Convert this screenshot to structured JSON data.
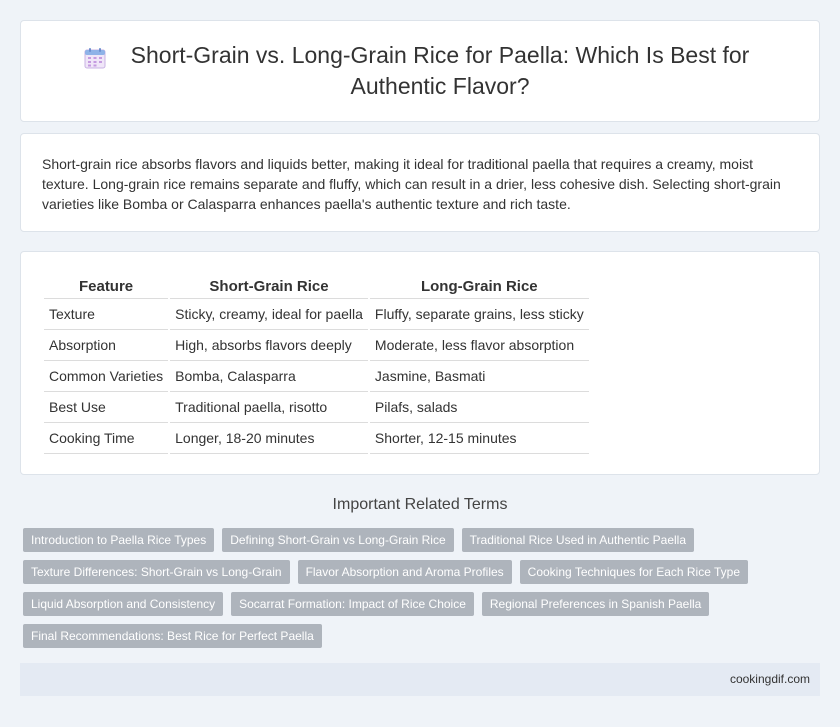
{
  "header": {
    "title": "Short-Grain vs. Long-Grain Rice for Paella: Which Is Best for Authentic Flavor?",
    "icon": "calendar-icon"
  },
  "intro": {
    "text": "Short-grain rice absorbs flavors and liquids better, making it ideal for traditional paella that requires a creamy, moist texture. Long-grain rice remains separate and fluffy, which can result in a drier, less cohesive dish. Selecting short-grain varieties like Bomba or Calasparra enhances paella's authentic texture and rich taste."
  },
  "table": {
    "headers": [
      "Feature",
      "Short-Grain Rice",
      "Long-Grain Rice"
    ],
    "rows": [
      [
        "Texture",
        "Sticky, creamy, ideal for paella",
        "Fluffy, separate grains, less sticky"
      ],
      [
        "Absorption",
        "High, absorbs flavors deeply",
        "Moderate, less flavor absorption"
      ],
      [
        "Common Varieties",
        "Bomba, Calasparra",
        "Jasmine, Basmati"
      ],
      [
        "Best Use",
        "Traditional paella, risotto",
        "Pilafs, salads"
      ],
      [
        "Cooking Time",
        "Longer, 18-20 minutes",
        "Shorter, 12-15 minutes"
      ]
    ]
  },
  "related": {
    "title": "Important Related Terms",
    "tags": [
      "Introduction to Paella Rice Types",
      "Defining Short-Grain vs Long-Grain Rice",
      "Traditional Rice Used in Authentic Paella",
      "Texture Differences: Short-Grain vs Long-Grain",
      "Flavor Absorption and Aroma Profiles",
      "Cooking Techniques for Each Rice Type",
      "Liquid Absorption and Consistency",
      "Socarrat Formation: Impact of Rice Choice",
      "Regional Preferences in Spanish Paella",
      "Final Recommendations: Best Rice for Perfect Paella"
    ]
  },
  "footer": {
    "site": "cookingdif.com"
  },
  "colors": {
    "background": "#eff3f8",
    "tag": "#aeb4bc",
    "footer": "#e4eaf3"
  }
}
